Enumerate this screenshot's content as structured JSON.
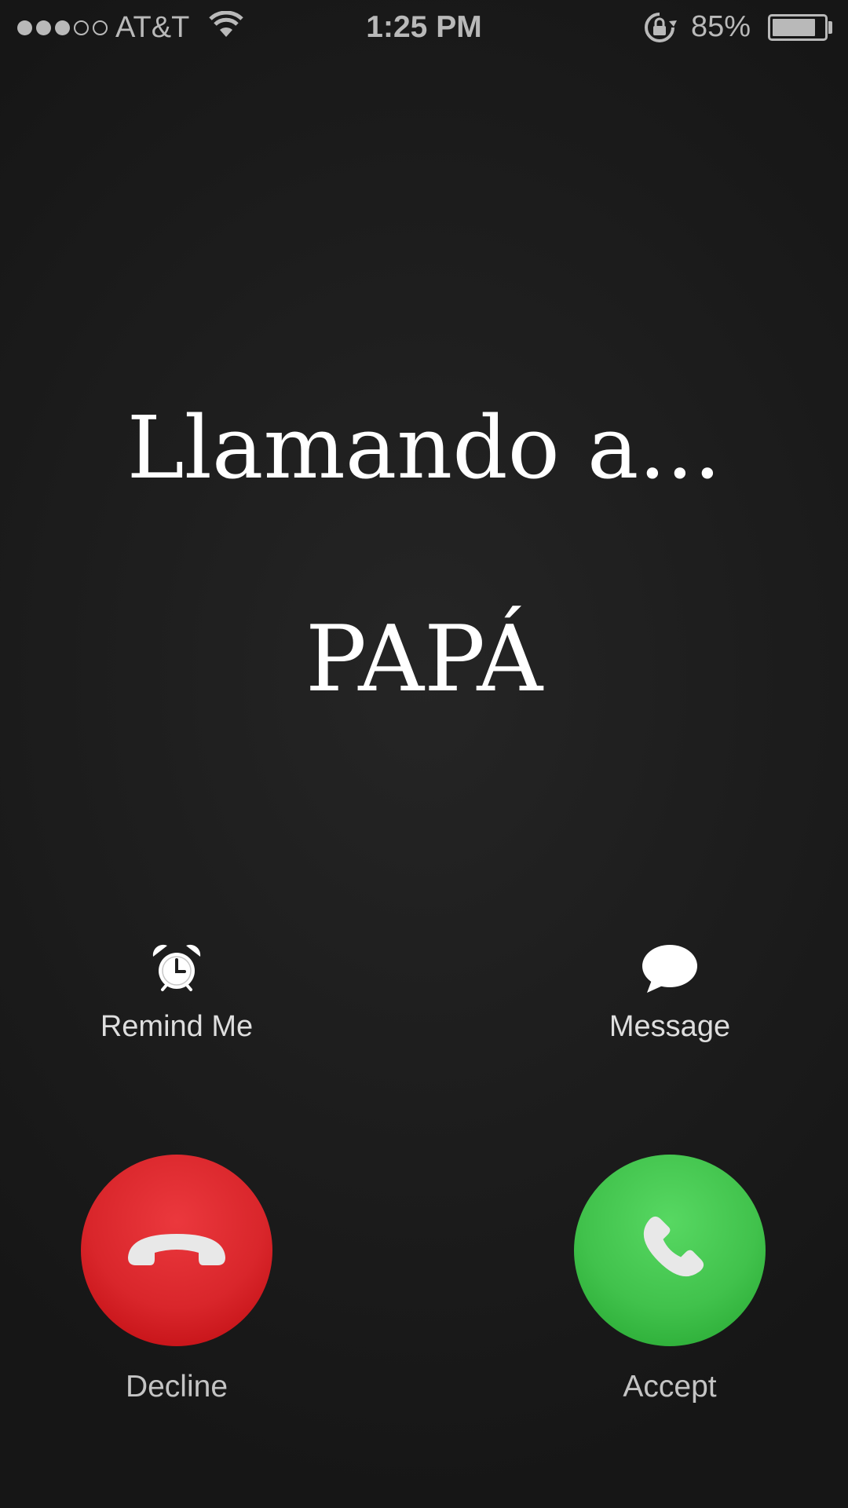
{
  "status_bar": {
    "signal_dots": [
      "full",
      "full",
      "full",
      "empty",
      "empty"
    ],
    "carrier": "AT&T",
    "time": "1:25 PM",
    "battery_percent_text": "85%",
    "battery_level": 0.85,
    "icons": [
      "wifi-icon",
      "rotation-lock-icon",
      "battery-icon"
    ]
  },
  "call": {
    "calling_text": "Llamando a...",
    "caller_name": "PAPÁ"
  },
  "options": {
    "remind_label": "Remind Me",
    "remind_icon": "alarm-clock-icon",
    "message_label": "Message",
    "message_icon": "speech-bubble-icon"
  },
  "buttons": {
    "decline_label": "Decline",
    "decline_icon": "phone-hangup-icon",
    "decline_color": "#d9262b",
    "accept_label": "Accept",
    "accept_icon": "phone-icon",
    "accept_color": "#41c24c"
  }
}
